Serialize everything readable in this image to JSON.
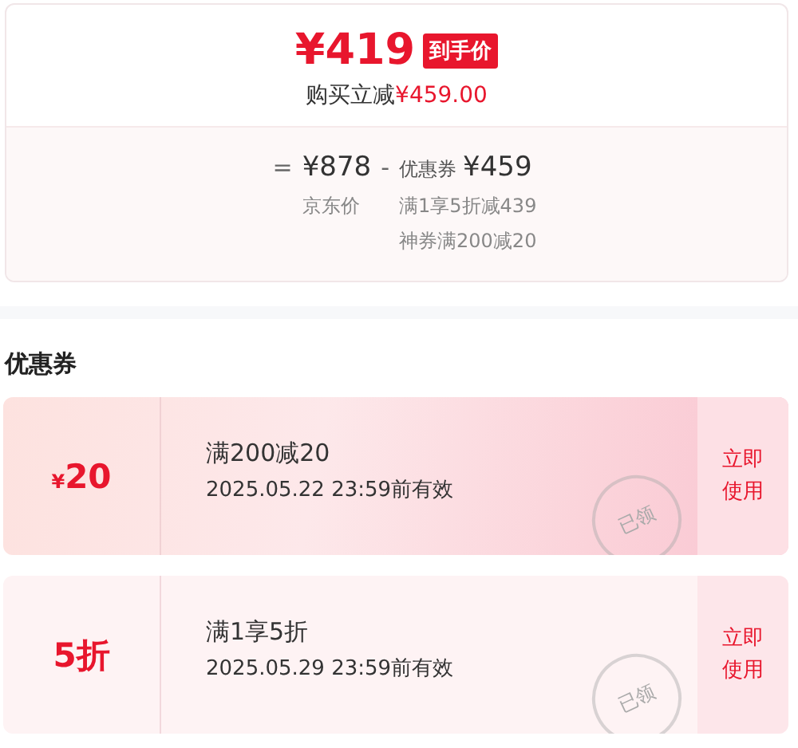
{
  "price_card": {
    "final_price": "¥419",
    "final_badge": "到手价",
    "saving_label": "购买立减",
    "saving_amount": "¥459.00",
    "equals": "=",
    "base_price": "¥878",
    "base_label": "京东价",
    "minus": "-",
    "discount_label": "优惠券",
    "discount_amount": "¥459",
    "discount_details": [
      "满1享5折减439",
      "神券满200减20"
    ]
  },
  "coupons_section": {
    "title": "优惠券",
    "coupons": [
      {
        "currency": "¥",
        "amount": "20",
        "condition": "满200减20",
        "validity": "2025.05.22 23:59前有效",
        "action": "立即使用",
        "stamp": "已领",
        "highlighted": true
      },
      {
        "amount": "5折",
        "condition": "满1享5折",
        "validity": "2025.05.29 23:59前有效",
        "action": "立即使用",
        "stamp": "已领",
        "highlighted": false
      }
    ]
  }
}
